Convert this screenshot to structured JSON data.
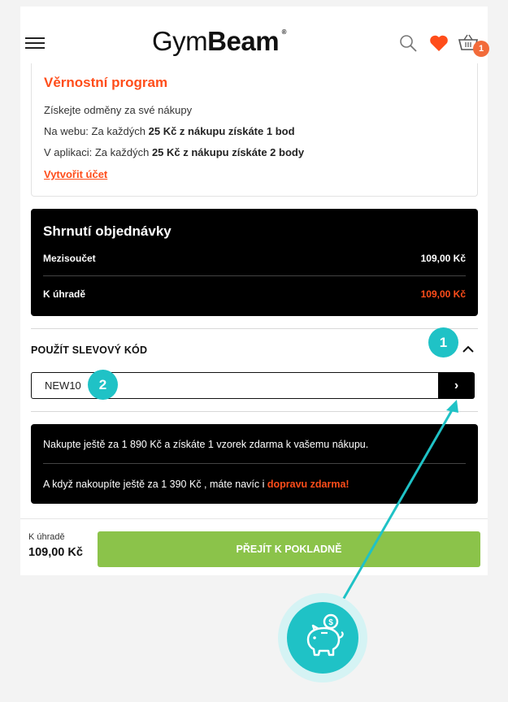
{
  "header": {
    "logo_light": "Gym",
    "logo_bold": "Beam",
    "logo_mark": "®",
    "cart_count": "1",
    "icons": [
      "menu-icon",
      "search-icon",
      "heart-icon",
      "cart-icon"
    ]
  },
  "loyalty": {
    "title": "Věrnostní program",
    "intro": "Získejte odměny za své nákupy",
    "web_prefix": "Na webu: Za každých ",
    "web_bold": "25 Kč z nákupu získáte 1 bod",
    "app_prefix": "V aplikaci: Za každých ",
    "app_bold": "25 Kč z nákupu získáte 2 body",
    "create_account": "Vytvořit účet"
  },
  "summary": {
    "title": "Shrnutí objednávky",
    "subtotal_label": "Mezisoučet",
    "subtotal_value": "109,00 Kč",
    "total_label": "K úhradě",
    "total_value": "109,00 Kč"
  },
  "coupon": {
    "title": "POUŽÍT SLEVOVÝ KÓD",
    "value": "NEW10",
    "submit_glyph": "›"
  },
  "promo": {
    "line1": "Nakupte ještě za 1 890 Kč a získáte 1 vzorek zdarma k vašemu nákupu.",
    "line2_prefix": "A když nakoupíte ještě za 1 390 Kč , máte navíc i ",
    "line2_highlight": "dopravu zdarma!"
  },
  "bottom": {
    "due_label": "K úhradě",
    "due_value": "109,00 Kč",
    "checkout_label": "PŘEJÍT K POKLADNĚ"
  },
  "annotations": {
    "step1": "1",
    "step2": "2",
    "accent_color": "#1fc2c6",
    "icon": "piggy-bank-icon"
  },
  "colors": {
    "brand_orange": "#ff4d1a",
    "checkout_green": "#8bc34a",
    "cart_badge": "#f26b3a"
  }
}
